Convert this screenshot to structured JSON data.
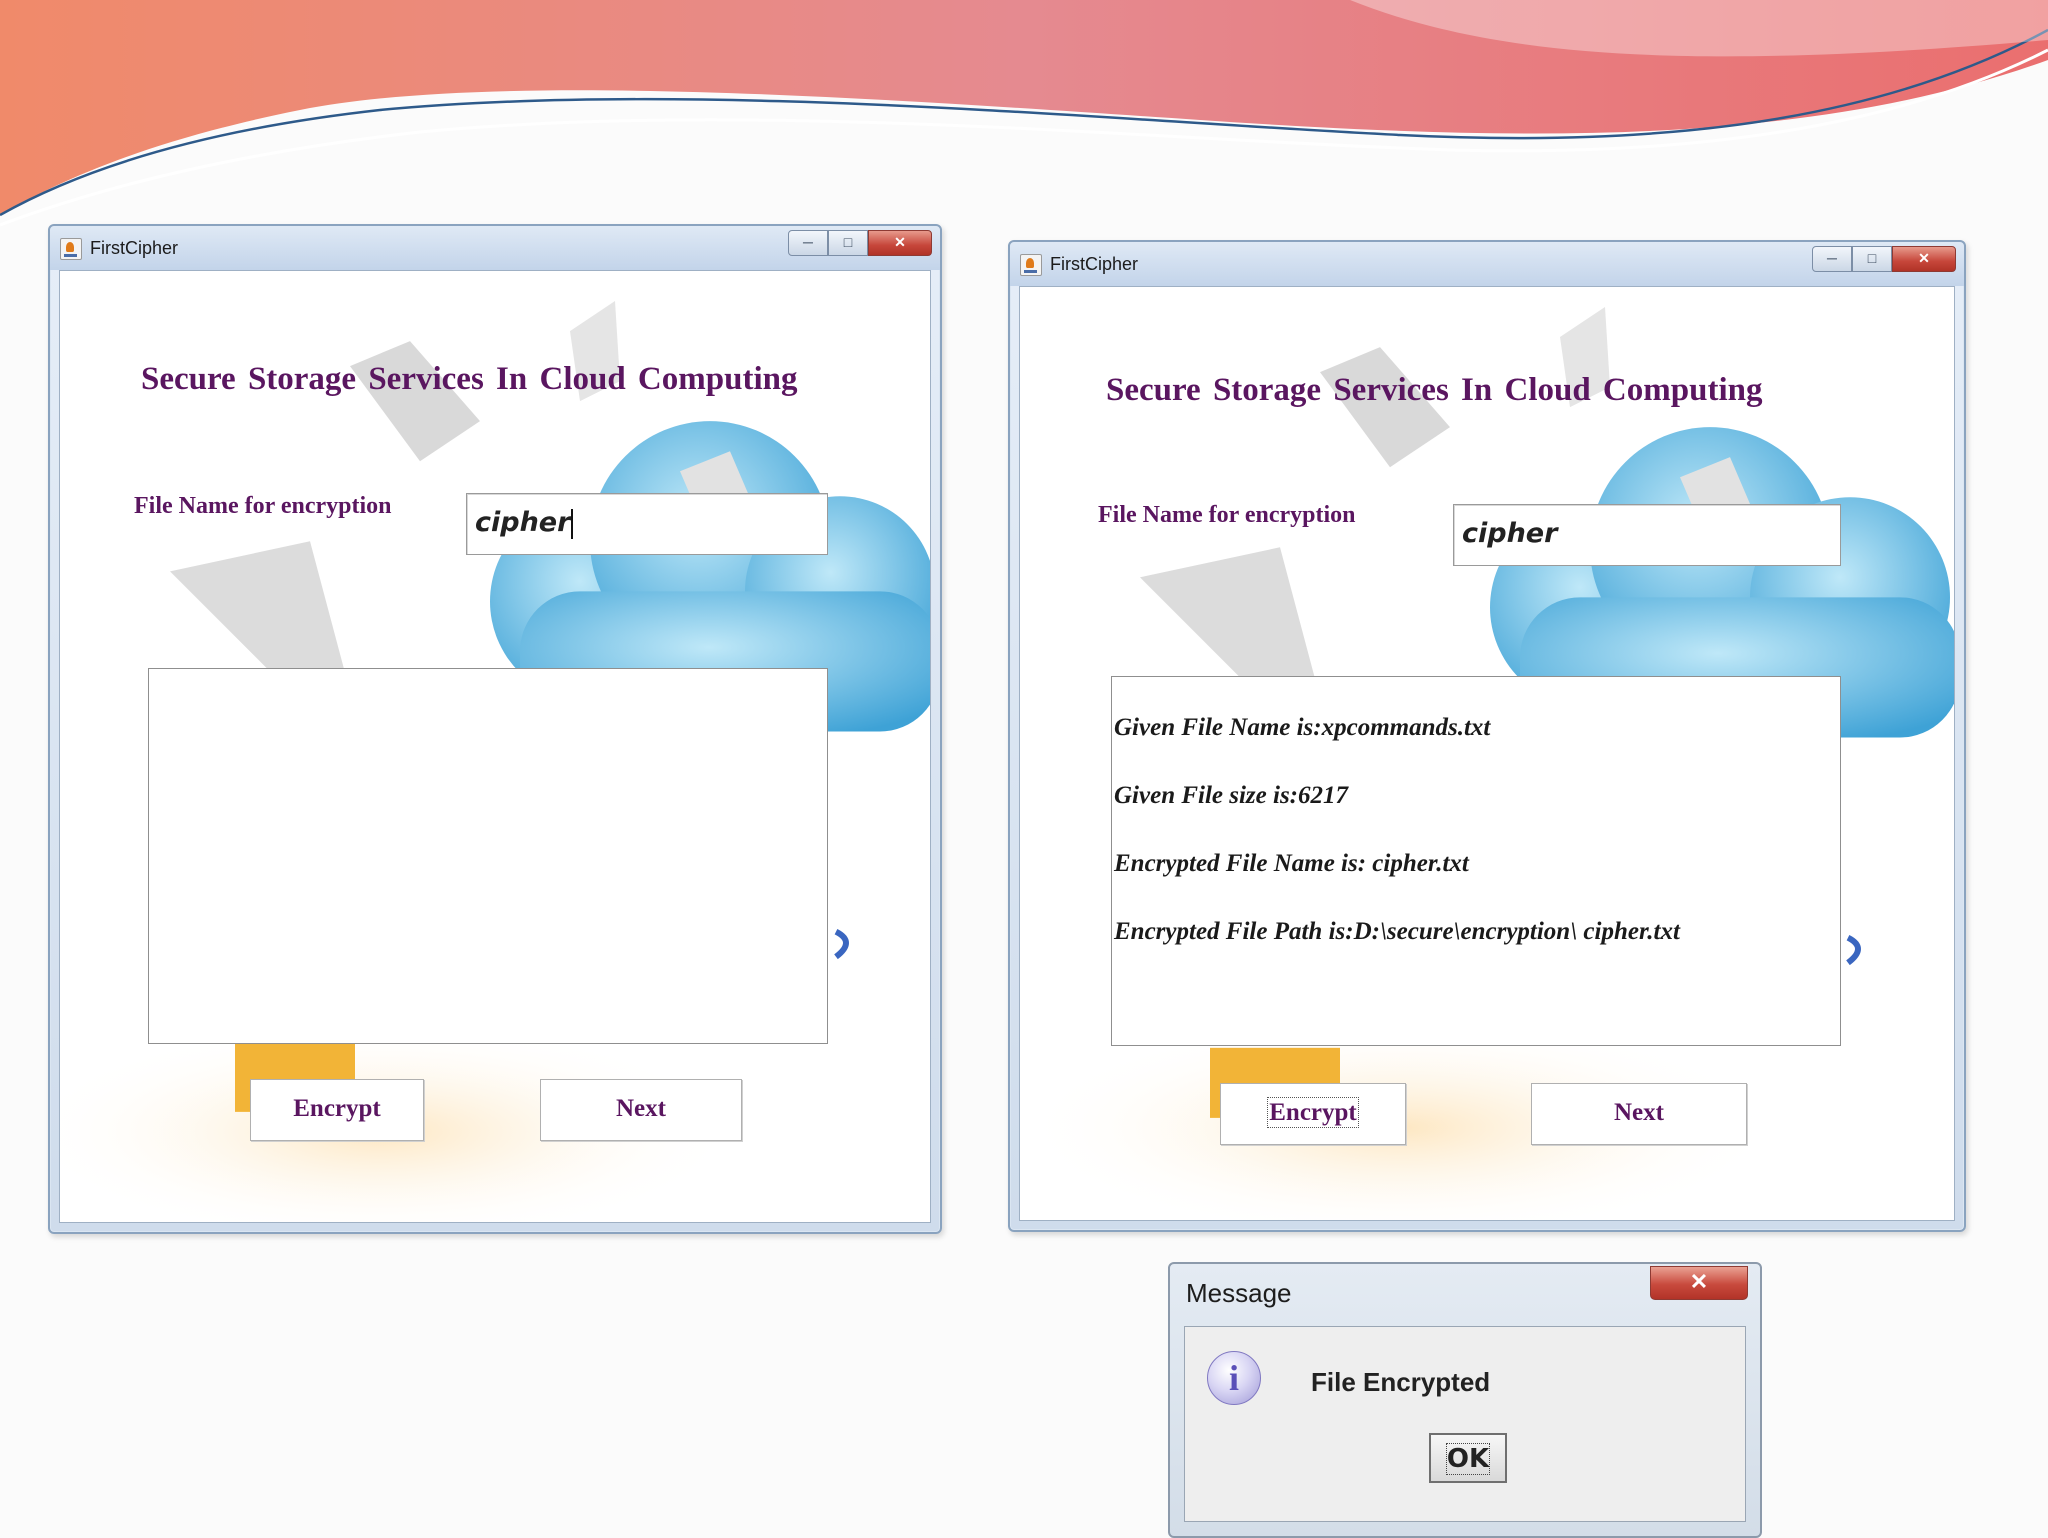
{
  "window_left": {
    "title": "FirstCipher",
    "heading": "Secure Storage  Services  In Cloud Computing",
    "file_label": "File Name for encryption",
    "file_value": "cipher",
    "output_lines": [],
    "encrypt_label": "Encrypt",
    "next_label": "Next"
  },
  "window_right": {
    "title": "FirstCipher",
    "heading": "Secure Storage  Services  In Cloud Computing",
    "file_label": "File Name for encryption",
    "file_value": "cipher",
    "output_lines": [
      "Given File Name is:xpcommands.txt",
      "Given File size is:6217",
      "Encrypted File Name is: cipher.txt",
      "Encrypted File Path is:D:\\secure\\encryption\\ cipher.txt"
    ],
    "encrypt_label": "Encrypt",
    "next_label": "Next"
  },
  "dialog": {
    "title": "Message",
    "message": "File Encrypted",
    "ok_label": "OK",
    "icon": "info-icon"
  },
  "colors": {
    "heading": "#5a1660",
    "banner_primary": "#e8847a",
    "close_button": "#c6463a"
  }
}
